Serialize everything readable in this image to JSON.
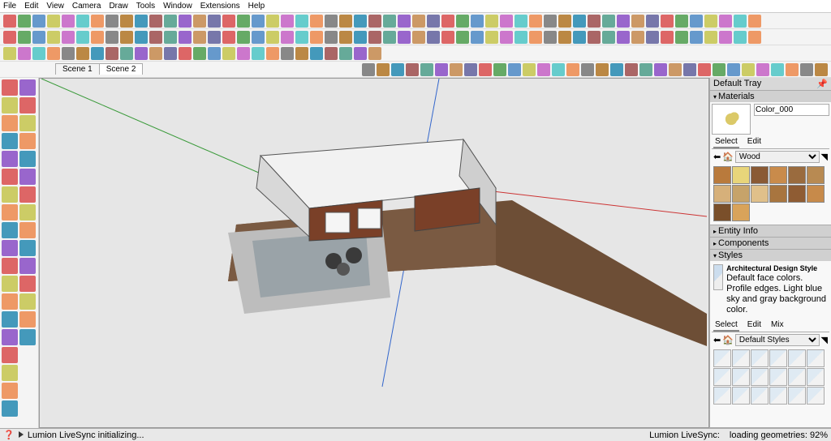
{
  "menu": [
    "File",
    "Edit",
    "View",
    "Camera",
    "Draw",
    "Tools",
    "Window",
    "Extensions",
    "Help"
  ],
  "scenes": [
    "Scene 1",
    "Scene 2"
  ],
  "activeScene": 1,
  "tray": {
    "title": "Default Tray"
  },
  "materials": {
    "title": "Materials",
    "name": "Color_000",
    "tabs": [
      "Select",
      "Edit"
    ],
    "library": "Wood",
    "swatches": [
      "#b97a3c",
      "#e8d57a",
      "#8a5a34",
      "#c98b4b",
      "#9a6b3e",
      "#b88a52",
      "#d6b07a",
      "#c6a36a",
      "#e0c08a",
      "#a8753f",
      "#8f5c33",
      "#c78a4a",
      "#7a4f2a",
      "#d9a35a"
    ]
  },
  "sections": {
    "entity": "Entity Info",
    "components": "Components",
    "styles": "Styles"
  },
  "styles": {
    "name": "Architectural Design Style",
    "desc": "Default face colors. Profile edges. Light blue sky and gray background color.",
    "tabs": [
      "Select",
      "Edit",
      "Mix"
    ],
    "library": "Default Styles",
    "count": 18
  },
  "status": {
    "left": "Lumion LiveSync initializing...",
    "sync": "Lumion LiveSync:",
    "loading": "loading geometries: 92%"
  },
  "toolbarRows": [
    52,
    52,
    26
  ],
  "leftToolCount": 34,
  "iconPalette": [
    "#d66",
    "#6a6",
    "#69c",
    "#cc6",
    "#c7c",
    "#6cc",
    "#e96",
    "#888",
    "#b84",
    "#49b",
    "#a66",
    "#6a9",
    "#96c",
    "#c96",
    "#77a"
  ]
}
